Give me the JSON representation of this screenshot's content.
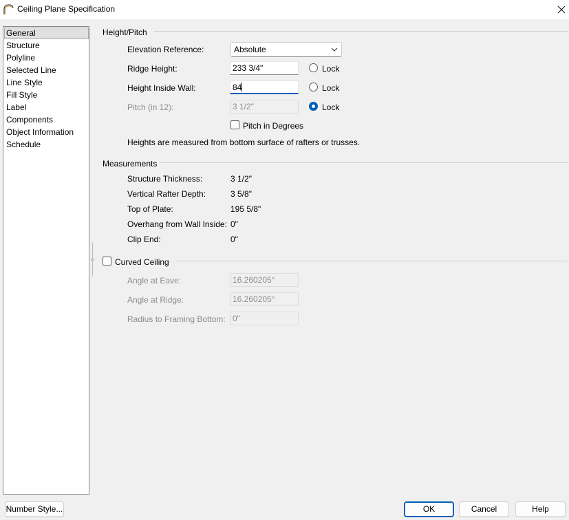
{
  "window": {
    "title": "Ceiling Plane Specification",
    "title_icon": "ceiling-arc-icon",
    "close_icon": "close-icon"
  },
  "sidebar": {
    "items": [
      {
        "label": "General",
        "selected": true
      },
      {
        "label": "Structure"
      },
      {
        "label": "Polyline"
      },
      {
        "label": "Selected Line"
      },
      {
        "label": "Line Style"
      },
      {
        "label": "Fill Style"
      },
      {
        "label": "Label"
      },
      {
        "label": "Components"
      },
      {
        "label": "Object Information"
      },
      {
        "label": "Schedule"
      }
    ]
  },
  "height_pitch": {
    "title": "Height/Pitch",
    "elevation_reference": {
      "label": "Elevation Reference:",
      "value": "Absolute"
    },
    "ridge_height": {
      "label": "Ridge Height:",
      "value": "233 3/4\"",
      "lock_label": "Lock",
      "locked": false
    },
    "height_inside_wall": {
      "label": "Height Inside Wall:",
      "value": "84",
      "lock_label": "Lock",
      "locked": false
    },
    "pitch": {
      "label": "Pitch (in 12):",
      "value": "3 1/2\"",
      "lock_label": "Lock",
      "locked": true
    },
    "pitch_in_degrees": {
      "label": "Pitch in Degrees",
      "checked": false
    },
    "note": "Heights are measured from bottom surface of rafters or trusses."
  },
  "measurements": {
    "title": "Measurements",
    "rows": [
      {
        "label": "Structure Thickness:",
        "value": "3 1/2\""
      },
      {
        "label": "Vertical Rafter Depth:",
        "value": "3 5/8\""
      },
      {
        "label": "Top of Plate:",
        "value": "195 5/8\""
      },
      {
        "label": "Overhang from Wall Inside:",
        "value": "0\""
      },
      {
        "label": "Clip End:",
        "value": "0\""
      }
    ]
  },
  "curved_ceiling": {
    "title": "Curved Ceiling",
    "checked": false,
    "angle_at_eave": {
      "label": "Angle at Eave:",
      "value": "16.260205°"
    },
    "angle_at_ridge": {
      "label": "Angle at Ridge:",
      "value": "16.260205°"
    },
    "radius": {
      "label": "Radius to Framing Bottom:",
      "value": "0\""
    }
  },
  "footer": {
    "number_style": "Number Style...",
    "ok": "OK",
    "cancel": "Cancel",
    "help": "Help"
  },
  "colors": {
    "accent": "#005fb8",
    "background": "#f0f0f0",
    "disabled_text": "#8c8c8c"
  }
}
